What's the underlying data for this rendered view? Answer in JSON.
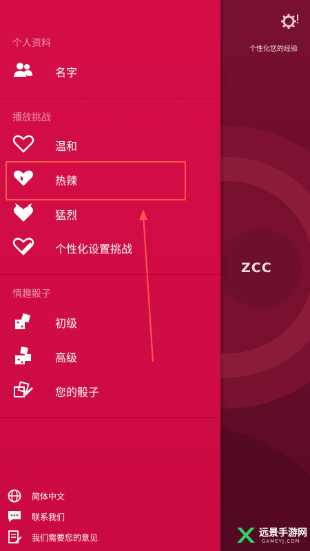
{
  "header": {
    "personalize_text": "个性化您的经验",
    "settings_icon": "gear-alert-icon"
  },
  "profile_circle": {
    "text": "ZCC"
  },
  "drawer": {
    "section_profile": "个人资料",
    "profile_items": [
      {
        "label": "名字",
        "icon": "users-icon"
      }
    ],
    "section_challenges": "播放挑战",
    "challenge_items": [
      {
        "label": "温和",
        "icon": "heart-outline-icon"
      },
      {
        "label": "热辣",
        "icon": "heart-flame-icon",
        "highlighted": true
      },
      {
        "label": "猛烈",
        "icon": "heart-devil-icon"
      },
      {
        "label": "个性化设置挑战",
        "icon": "heart-pencil-icon"
      }
    ],
    "section_dice": "情趣骰子",
    "dice_items": [
      {
        "label": "初级",
        "icon": "dice-basic-icon"
      },
      {
        "label": "高级",
        "icon": "dice-advanced-icon"
      },
      {
        "label": "您的骰子",
        "icon": "dice-pencil-icon"
      }
    ],
    "bottom_items": [
      {
        "label": "简体中文",
        "icon": "globe-icon"
      },
      {
        "label": "联系我们",
        "icon": "chat-icon"
      },
      {
        "label": "我们需要您的意见",
        "icon": "feedback-icon"
      }
    ]
  },
  "watermark": {
    "title": "远景手游网",
    "subtitle": "GAMEYJ.COM"
  },
  "colors": {
    "drawer_bg": "#d20c45",
    "panel_bg": "#6a0d2a",
    "highlight_border": "#ff5a4a"
  }
}
